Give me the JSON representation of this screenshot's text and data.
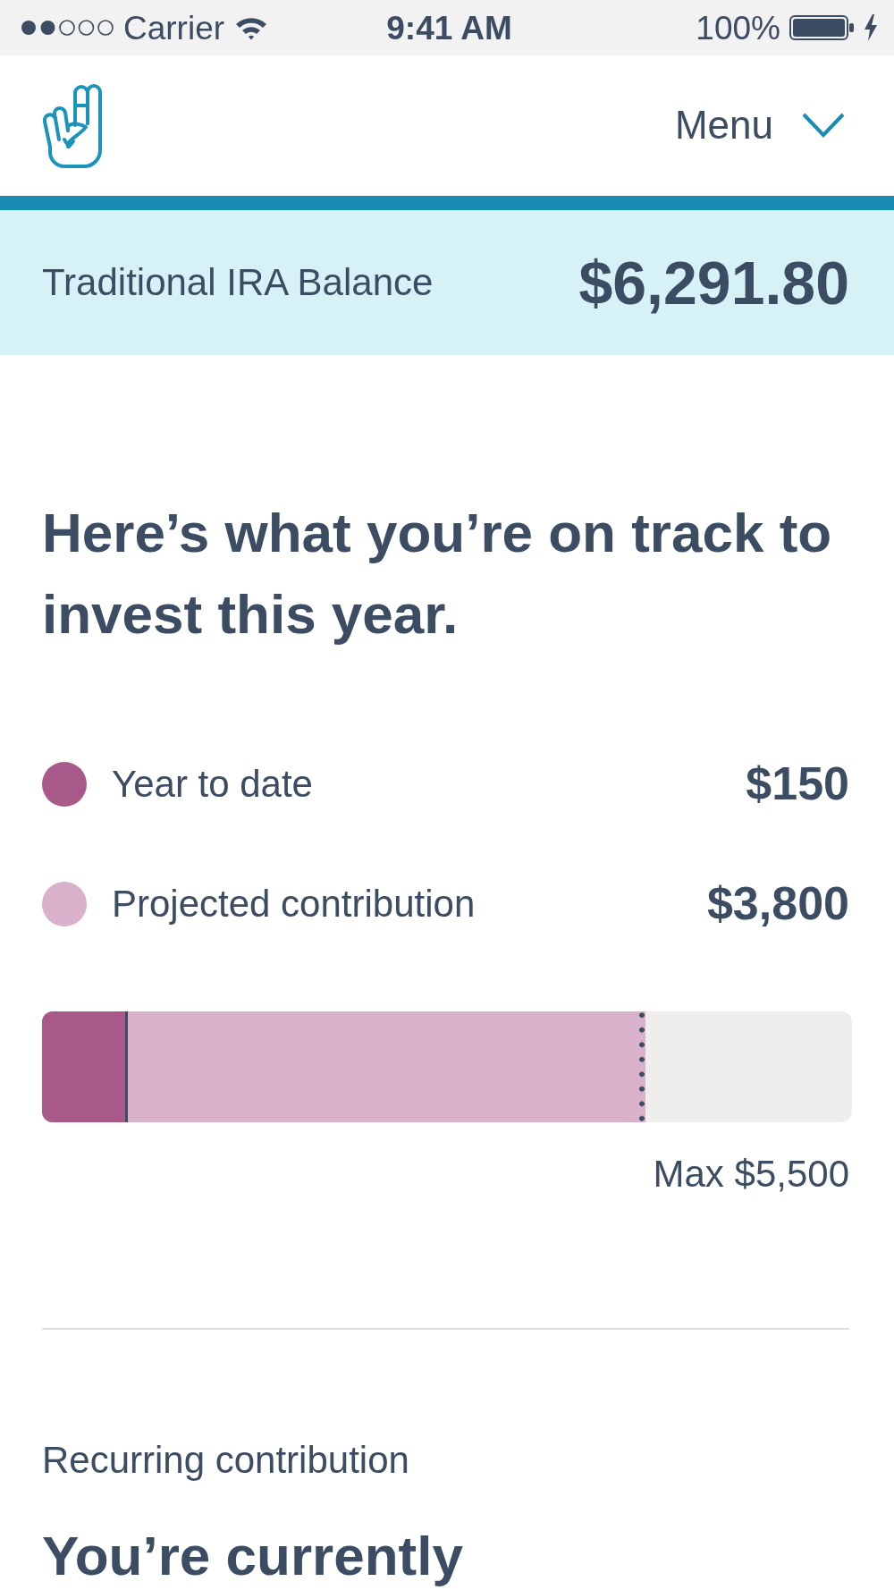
{
  "status_bar": {
    "carrier": "Carrier",
    "time": "9:41 AM",
    "battery": "100%"
  },
  "header": {
    "menu": "Menu"
  },
  "balance": {
    "label": "Traditional IRA Balance",
    "amount": "$6,291.80"
  },
  "projection": {
    "heading": "Here’s what you’re on track to invest this year.",
    "legend": [
      {
        "label": "Year to date",
        "amount": "$150",
        "color": "#a8598a"
      },
      {
        "label": "Projected contribution",
        "amount": "$3,800",
        "color": "#d9b1ca"
      }
    ],
    "bar": {
      "segments": [
        {
          "kind": "actual",
          "level": 0.106
        },
        {
          "kind": "projected",
          "level": 0.745
        }
      ]
    },
    "max_label": "Max $5,500"
  },
  "recurring": {
    "label": "Recurring contribution",
    "heading": "You’re currently"
  }
}
